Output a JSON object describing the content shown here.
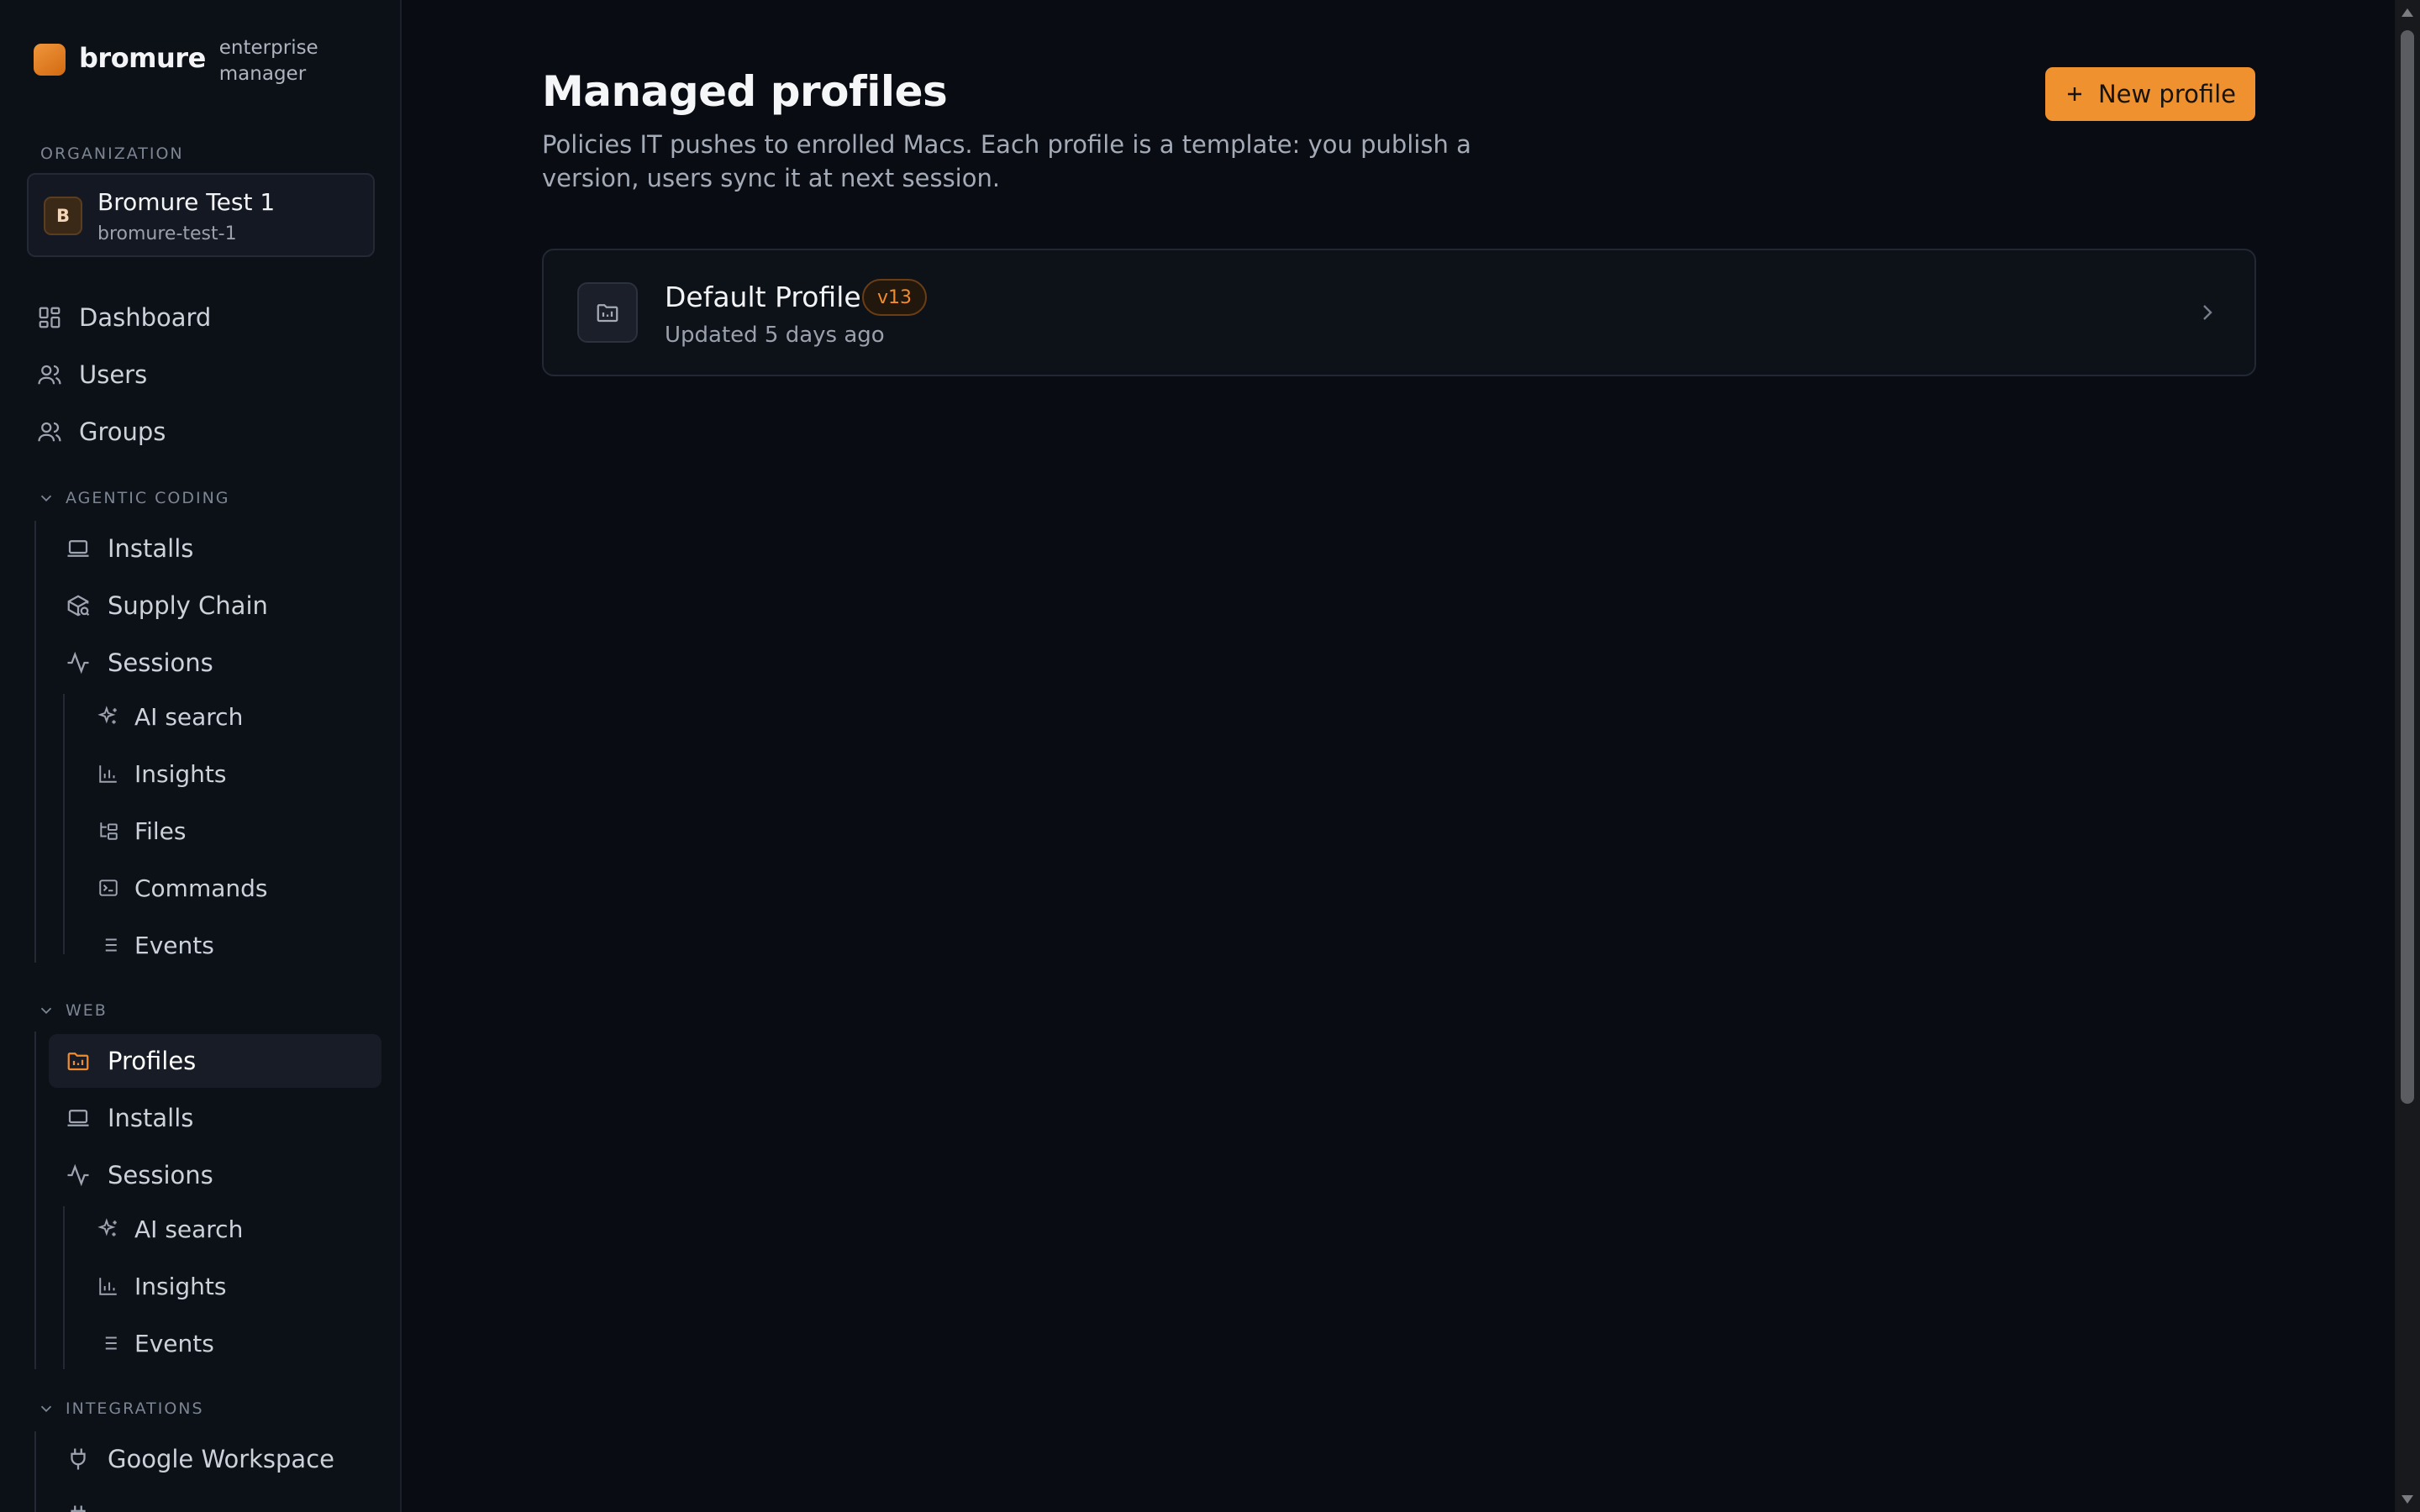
{
  "brand": {
    "name": "bromure",
    "subtitle": "enterprise manager"
  },
  "organization": {
    "section_label": "ORGANIZATION",
    "avatar_letter": "B",
    "name": "Bromure Test 1",
    "slug": "bromure-test-1"
  },
  "nav": {
    "top": [
      {
        "label": "Dashboard",
        "icon": "dashboard-icon"
      },
      {
        "label": "Users",
        "icon": "user-icon"
      },
      {
        "label": "Groups",
        "icon": "users-icon"
      }
    ],
    "agentic_coding": {
      "label": "AGENTIC CODING",
      "items": [
        {
          "label": "Installs",
          "icon": "laptop-icon"
        },
        {
          "label": "Supply Chain",
          "icon": "package-search-icon"
        },
        {
          "label": "Sessions",
          "icon": "activity-icon"
        }
      ],
      "sub_items": [
        {
          "label": "AI search",
          "icon": "sparkles-icon"
        },
        {
          "label": "Insights",
          "icon": "bar-chart-icon"
        },
        {
          "label": "Files",
          "icon": "folder-tree-icon"
        },
        {
          "label": "Commands",
          "icon": "terminal-icon"
        },
        {
          "label": "Events",
          "icon": "list-icon"
        }
      ]
    },
    "web": {
      "label": "WEB",
      "items": [
        {
          "label": "Profiles",
          "icon": "folder-chart-icon",
          "active": true
        },
        {
          "label": "Installs",
          "icon": "laptop-icon"
        },
        {
          "label": "Sessions",
          "icon": "activity-icon"
        }
      ],
      "sub_items": [
        {
          "label": "AI search",
          "icon": "sparkles-icon"
        },
        {
          "label": "Insights",
          "icon": "bar-chart-icon"
        },
        {
          "label": "Events",
          "icon": "list-icon"
        }
      ]
    },
    "integrations": {
      "label": "INTEGRATIONS",
      "items": [
        {
          "label": "Google Workspace",
          "icon": "plug-icon"
        }
      ]
    }
  },
  "main": {
    "title": "Managed profiles",
    "description": "Policies IT pushes to enrolled Macs. Each profile is a template: you publish a version, users sync it at next session.",
    "new_button_label": "New profile",
    "profiles": [
      {
        "name": "Default Profile",
        "version": "v13",
        "updated": "Updated 5 days ago"
      }
    ]
  },
  "colors": {
    "accent": "#f0912f",
    "background": "#090c12",
    "sidebar": "#0c1017"
  }
}
